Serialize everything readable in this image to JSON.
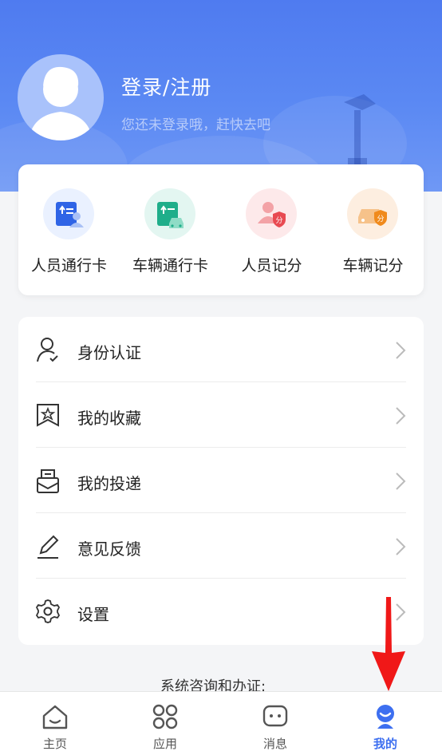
{
  "profile": {
    "login_title": "登录/注册",
    "login_subtitle": "您还未登录哦，赶快去吧",
    "avatar_icon": "default-avatar-icon"
  },
  "quick_actions": [
    {
      "label": "人员通行卡",
      "icon": "person-pass-card-icon",
      "bg": "#eaf1ff"
    },
    {
      "label": "车辆通行卡",
      "icon": "vehicle-pass-card-icon",
      "bg": "#e3f6f1"
    },
    {
      "label": "人员记分",
      "icon": "person-score-icon",
      "bg": "#fde9ea"
    },
    {
      "label": "车辆记分",
      "icon": "vehicle-score-icon",
      "bg": "#fdeee0"
    }
  ],
  "menu": [
    {
      "label": "身份认证",
      "icon": "identity-verify-icon"
    },
    {
      "label": "我的收藏",
      "icon": "favorites-icon"
    },
    {
      "label": "我的投递",
      "icon": "submissions-icon"
    },
    {
      "label": "意见反馈",
      "icon": "feedback-pencil-icon"
    },
    {
      "label": "设置",
      "icon": "settings-gear-icon"
    }
  ],
  "consult_text": "系统咨询和办证:",
  "tabbar": [
    {
      "label": "主页",
      "icon": "home-icon",
      "active": false
    },
    {
      "label": "应用",
      "icon": "apps-icon",
      "active": false
    },
    {
      "label": "消息",
      "icon": "message-icon",
      "active": false
    },
    {
      "label": "我的",
      "icon": "profile-icon",
      "active": true
    }
  ],
  "colors": {
    "accent": "#3d6ff0",
    "header": "#5585f2",
    "annotation_arrow": "#f01818"
  }
}
